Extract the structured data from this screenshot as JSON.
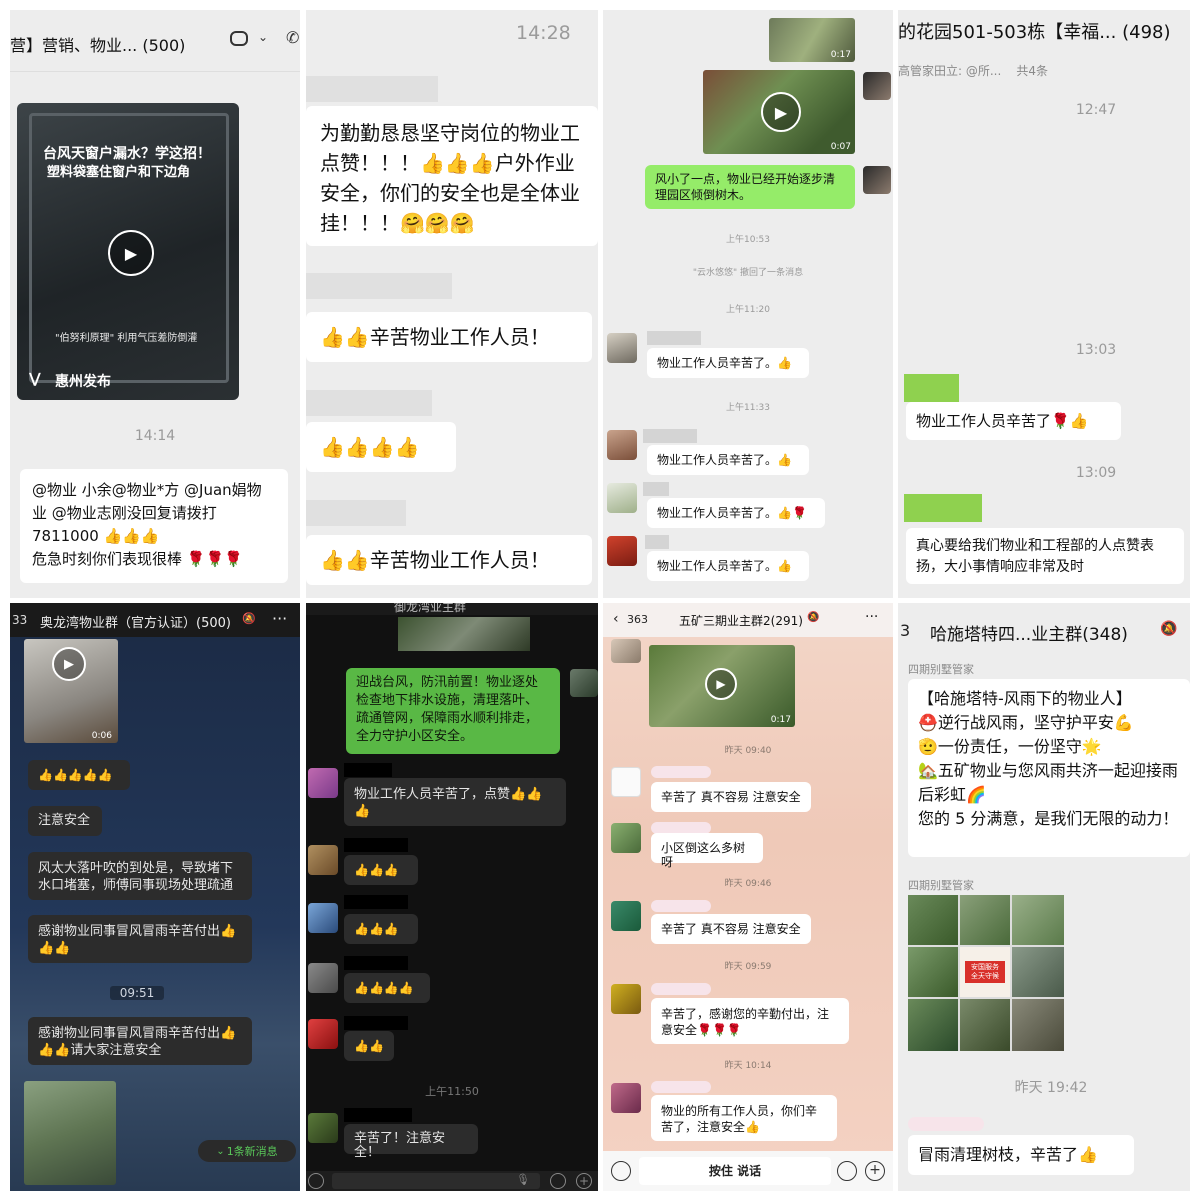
{
  "p1": {
    "title": "营】营销、物业... (500)",
    "chat_icon": "chat-bubble-icon",
    "video": {
      "line1": "台风天窗户漏水？学这招！",
      "line2": "塑料袋塞住窗户和下边角",
      "caption": "\"伯努利原理\" 利用气压差防倒灌",
      "source": "惠州发布"
    },
    "time": "14:14",
    "message": "@物业 小余@物业*方 @Juan娟物业 @物业志刚没回复请拨打7811000 👍👍👍\n危急时刻你们表现很棒 🌹🌹🌹"
  },
  "p2": {
    "time": "14:28",
    "message1": "为勤勤恳恳坚守岗位的物业工点赞！！！👍👍👍户外作业安全，你们的安全也是全体业挂！！！🤗🤗🤗",
    "message2": "👍👍辛苦物业工作人员！",
    "message3": "👍👍👍👍",
    "message4": "👍👍辛苦物业工作人员！"
  },
  "p3": {
    "video1_duration": "0:17",
    "video2_duration": "0:07",
    "green_message": "风小了一点，物业已经开始逐步清理园区倾倒树木。",
    "time1": "上午10:53",
    "recall": "\"云水悠悠\" 撤回了一条消息",
    "time2": "上午11:20",
    "msg_a": "物业工作人员辛苦了。👍",
    "time3": "上午11:33",
    "msg_b": "物业工作人员辛苦了。👍",
    "msg_c": "物业工作人员辛苦了。👍🌹",
    "msg_d": "物业工作人员辛苦了。👍"
  },
  "p4": {
    "title": "的花园501-503栋【幸福... (498)",
    "pinned": "高管家田立: @所...",
    "pinned_count": "共4条",
    "time1": "12:47",
    "time2": "13:03",
    "msg1": "物业工作人员辛苦了🌹👍",
    "time3": "13:09",
    "msg2": "真心要给我们物业和工程部的人点赞表扬，大小事情响应非常及时"
  },
  "p5": {
    "badge": "33",
    "title": "奥龙湾物业群（官方认证）(500)",
    "more": "···",
    "video_duration": "0:06",
    "msg1": "👍👍👍👍👍",
    "msg2": "注意安全",
    "msg3": "风太大落叶吹的到处是，导致堵下水口堵塞，师傅同事现场处理疏通",
    "msg4": "感谢物业同事冒风冒雨辛苦付出👍👍👍",
    "time": "09:51",
    "msg5": "感谢物业同事冒风冒雨辛苦付出👍👍👍请大家注意安全",
    "new_msg": "1条新消息"
  },
  "p6": {
    "title": "御龙湾业主群",
    "green": "迎战台风，防汛前置！物业逐处检查地下排水设施，清理落叶、疏通管网，保障雨水顺利排走，全力守护小区安全。",
    "msg1": "物业工作人员辛苦了，点赞👍👍👍",
    "msg2": "👍👍👍",
    "msg3": "👍👍👍",
    "msg4": "👍👍👍👍",
    "msg5": "👍👍",
    "time": "上午11:50",
    "msg6": "辛苦了！注意安全！"
  },
  "p7": {
    "badge": "363",
    "title": "五矿三期业主群2(291)",
    "video_duration": "0:17",
    "time1": "昨天 09:40",
    "msg1": "辛苦了 真不容易 注意安全",
    "msg2": "小区倒这么多树呀",
    "time2": "昨天 09:46",
    "msg3": "辛苦了 真不容易 注意安全",
    "time3": "昨天 09:59",
    "msg4": "辛苦了，感谢您的辛勤付出，注意安全🌹🌹🌹",
    "time4": "昨天 10:14",
    "msg5": "物业的所有工作人员，你们辛苦了，注意安全👍",
    "hold_to_talk": "按住 说话"
  },
  "p8": {
    "badge": "3",
    "title": "哈施塔特四...业主群(348)",
    "sender1": "四期别墅管家",
    "message": "【哈施塔特-风雨下的物业人】\n⛑️逆行战风雨，坚守护平安💪\n🫡一份责任，一份坚守🌟\n🏡五矿物业与您风雨共济一起迎接雨后彩虹🌈\n您的 5 分满意，是我们无限的动力！",
    "sender2": "四期别墅管家",
    "photo_sign": "安国服务 全天守候",
    "time": "昨天 19:42",
    "msg_last": "冒雨清理树枝，辛苦了👍"
  }
}
